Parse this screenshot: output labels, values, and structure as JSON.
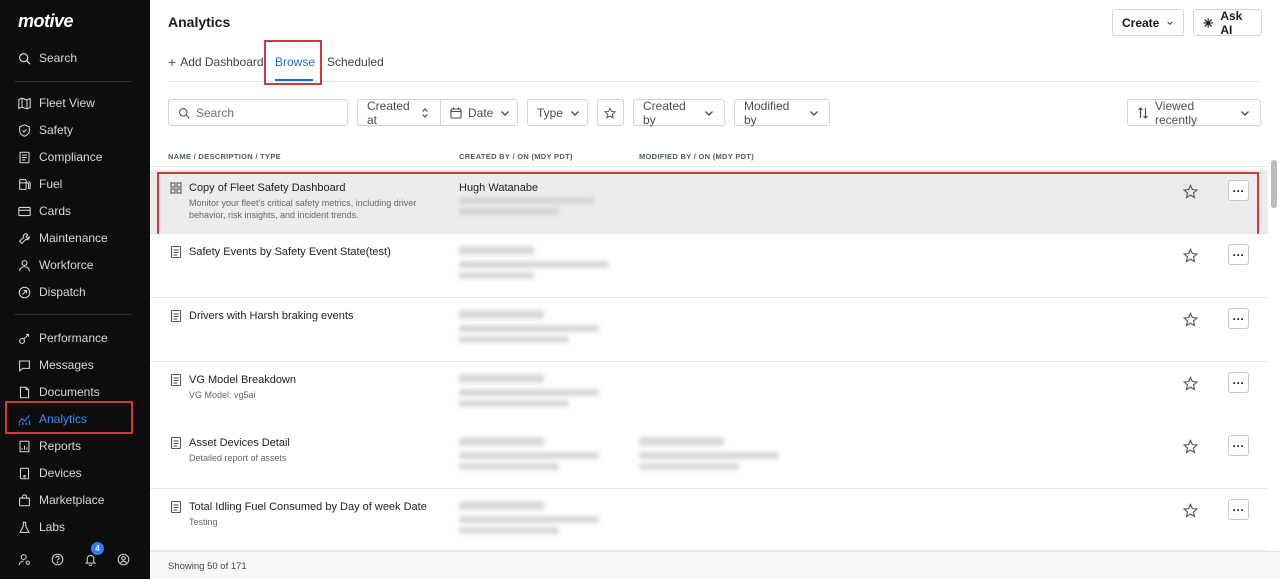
{
  "app": {
    "logo": "motive"
  },
  "sidebar": {
    "search_label": "Search",
    "items": [
      {
        "label": "Fleet View",
        "icon": "map-icon"
      },
      {
        "label": "Safety",
        "icon": "shield-icon"
      },
      {
        "label": "Compliance",
        "icon": "compliance-icon"
      },
      {
        "label": "Fuel",
        "icon": "fuel-icon"
      },
      {
        "label": "Cards",
        "icon": "card-icon"
      },
      {
        "label": "Maintenance",
        "icon": "wrench-icon"
      },
      {
        "label": "Workforce",
        "icon": "person-icon"
      },
      {
        "label": "Dispatch",
        "icon": "dispatch-icon"
      },
      {
        "label": "Performance",
        "icon": "performance-icon"
      },
      {
        "label": "Messages",
        "icon": "chat-icon"
      },
      {
        "label": "Documents",
        "icon": "document-icon"
      },
      {
        "label": "Analytics",
        "icon": "analytics-icon"
      },
      {
        "label": "Reports",
        "icon": "report-icon"
      },
      {
        "label": "Devices",
        "icon": "device-icon"
      },
      {
        "label": "Marketplace",
        "icon": "bag-icon"
      },
      {
        "label": "Labs",
        "icon": "flask-icon"
      }
    ],
    "active_item": "Analytics",
    "notification_count": "4"
  },
  "header": {
    "title": "Analytics",
    "create_label": "Create",
    "ask_ai_label": "Ask AI"
  },
  "tabs": {
    "add_dashboard": "Add Dashboard",
    "browse": "Browse",
    "scheduled": "Scheduled",
    "active": "Browse"
  },
  "filters": {
    "search_placeholder": "Search",
    "created_at": "Created at",
    "date": "Date",
    "type": "Type",
    "created_by": "Created by",
    "modified_by": "Modified by",
    "sort": "Viewed recently"
  },
  "table": {
    "columns": [
      "NAME / DESCRIPTION / TYPE",
      "CREATED BY / ON (MDY PDT)",
      "MODIFIED BY / ON (MDY PDT)"
    ],
    "rows": [
      {
        "title": "Copy of Fleet Safety Dashboard",
        "description": "Monitor your fleet's critical safety metrics, including driver behavior, risk insights, and incident trends.",
        "type_icon": "dashboard-icon",
        "created_by": "Hugh Watanabe",
        "highlighted": true
      },
      {
        "title": "Safety Events by Safety Event State(test)",
        "description": "",
        "type_icon": "report-icon",
        "created_by": "",
        "highlighted": false
      },
      {
        "title": "Drivers with Harsh braking events",
        "description": "",
        "type_icon": "report-icon",
        "created_by": "",
        "highlighted": false
      },
      {
        "title": "VG Model Breakdown",
        "description": "VG Model: vg5ai",
        "type_icon": "report-icon",
        "created_by": "",
        "highlighted": false
      },
      {
        "title": "Asset Devices Detail",
        "description": "Detailed report of assets",
        "type_icon": "report-icon",
        "created_by": "",
        "highlighted": false
      },
      {
        "title": "Total Idling Fuel Consumed by Day of week Date",
        "description": "Testing",
        "type_icon": "report-icon",
        "created_by": "",
        "highlighted": false
      }
    ]
  },
  "footer": {
    "status": "Showing 50 of 171"
  },
  "colors": {
    "accent": "#2169d8",
    "sidebar_bg": "#0d0d0d",
    "highlight_border": "#d0383b"
  }
}
